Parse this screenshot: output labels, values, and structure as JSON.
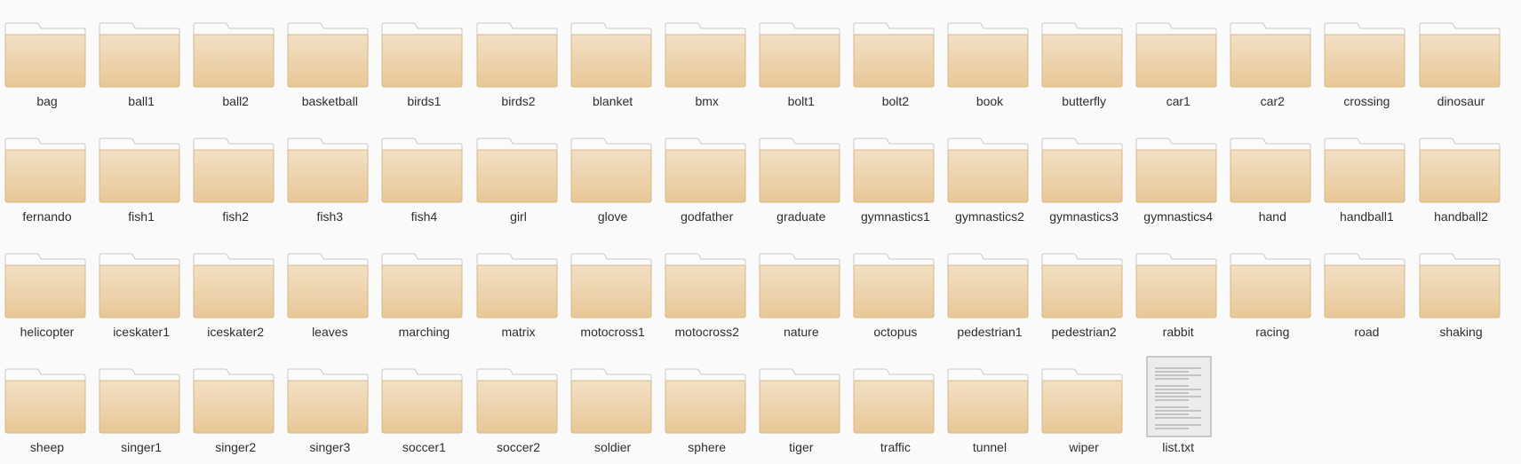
{
  "files": [
    {
      "name": "bag",
      "kind": "folder"
    },
    {
      "name": "ball1",
      "kind": "folder"
    },
    {
      "name": "ball2",
      "kind": "folder"
    },
    {
      "name": "basketball",
      "kind": "folder"
    },
    {
      "name": "birds1",
      "kind": "folder"
    },
    {
      "name": "birds2",
      "kind": "folder"
    },
    {
      "name": "blanket",
      "kind": "folder"
    },
    {
      "name": "bmx",
      "kind": "folder"
    },
    {
      "name": "bolt1",
      "kind": "folder"
    },
    {
      "name": "bolt2",
      "kind": "folder"
    },
    {
      "name": "book",
      "kind": "folder"
    },
    {
      "name": "butterfly",
      "kind": "folder"
    },
    {
      "name": "car1",
      "kind": "folder"
    },
    {
      "name": "car2",
      "kind": "folder"
    },
    {
      "name": "crossing",
      "kind": "folder"
    },
    {
      "name": "dinosaur",
      "kind": "folder"
    },
    {
      "name": "fernando",
      "kind": "folder"
    },
    {
      "name": "fish1",
      "kind": "folder"
    },
    {
      "name": "fish2",
      "kind": "folder"
    },
    {
      "name": "fish3",
      "kind": "folder"
    },
    {
      "name": "fish4",
      "kind": "folder"
    },
    {
      "name": "girl",
      "kind": "folder"
    },
    {
      "name": "glove",
      "kind": "folder"
    },
    {
      "name": "godfather",
      "kind": "folder"
    },
    {
      "name": "graduate",
      "kind": "folder"
    },
    {
      "name": "gymnastics1",
      "kind": "folder"
    },
    {
      "name": "gymnastics2",
      "kind": "folder"
    },
    {
      "name": "gymnastics3",
      "kind": "folder"
    },
    {
      "name": "gymnastics4",
      "kind": "folder"
    },
    {
      "name": "hand",
      "kind": "folder"
    },
    {
      "name": "handball1",
      "kind": "folder"
    },
    {
      "name": "handball2",
      "kind": "folder"
    },
    {
      "name": "helicopter",
      "kind": "folder"
    },
    {
      "name": "iceskater1",
      "kind": "folder"
    },
    {
      "name": "iceskater2",
      "kind": "folder"
    },
    {
      "name": "leaves",
      "kind": "folder"
    },
    {
      "name": "marching",
      "kind": "folder"
    },
    {
      "name": "matrix",
      "kind": "folder"
    },
    {
      "name": "motocross1",
      "kind": "folder"
    },
    {
      "name": "motocross2",
      "kind": "folder"
    },
    {
      "name": "nature",
      "kind": "folder"
    },
    {
      "name": "octopus",
      "kind": "folder"
    },
    {
      "name": "pedestrian1",
      "kind": "folder"
    },
    {
      "name": "pedestrian2",
      "kind": "folder"
    },
    {
      "name": "rabbit",
      "kind": "folder"
    },
    {
      "name": "racing",
      "kind": "folder"
    },
    {
      "name": "road",
      "kind": "folder"
    },
    {
      "name": "shaking",
      "kind": "folder"
    },
    {
      "name": "sheep",
      "kind": "folder"
    },
    {
      "name": "singer1",
      "kind": "folder"
    },
    {
      "name": "singer2",
      "kind": "folder"
    },
    {
      "name": "singer3",
      "kind": "folder"
    },
    {
      "name": "soccer1",
      "kind": "folder"
    },
    {
      "name": "soccer2",
      "kind": "folder"
    },
    {
      "name": "soldier",
      "kind": "folder"
    },
    {
      "name": "sphere",
      "kind": "folder"
    },
    {
      "name": "tiger",
      "kind": "folder"
    },
    {
      "name": "traffic",
      "kind": "folder"
    },
    {
      "name": "tunnel",
      "kind": "folder"
    },
    {
      "name": "wiper",
      "kind": "folder"
    },
    {
      "name": "list.txt",
      "kind": "text-file"
    }
  ],
  "icons": {
    "folder": "folder-icon",
    "text-file": "text-file-icon"
  },
  "colors": {
    "background": "#fafafa",
    "folder_front_top": "#f2e0c5",
    "folder_front_bottom": "#e8c796",
    "folder_back": "#fbfbfb",
    "label_text": "#2e2e2e"
  }
}
